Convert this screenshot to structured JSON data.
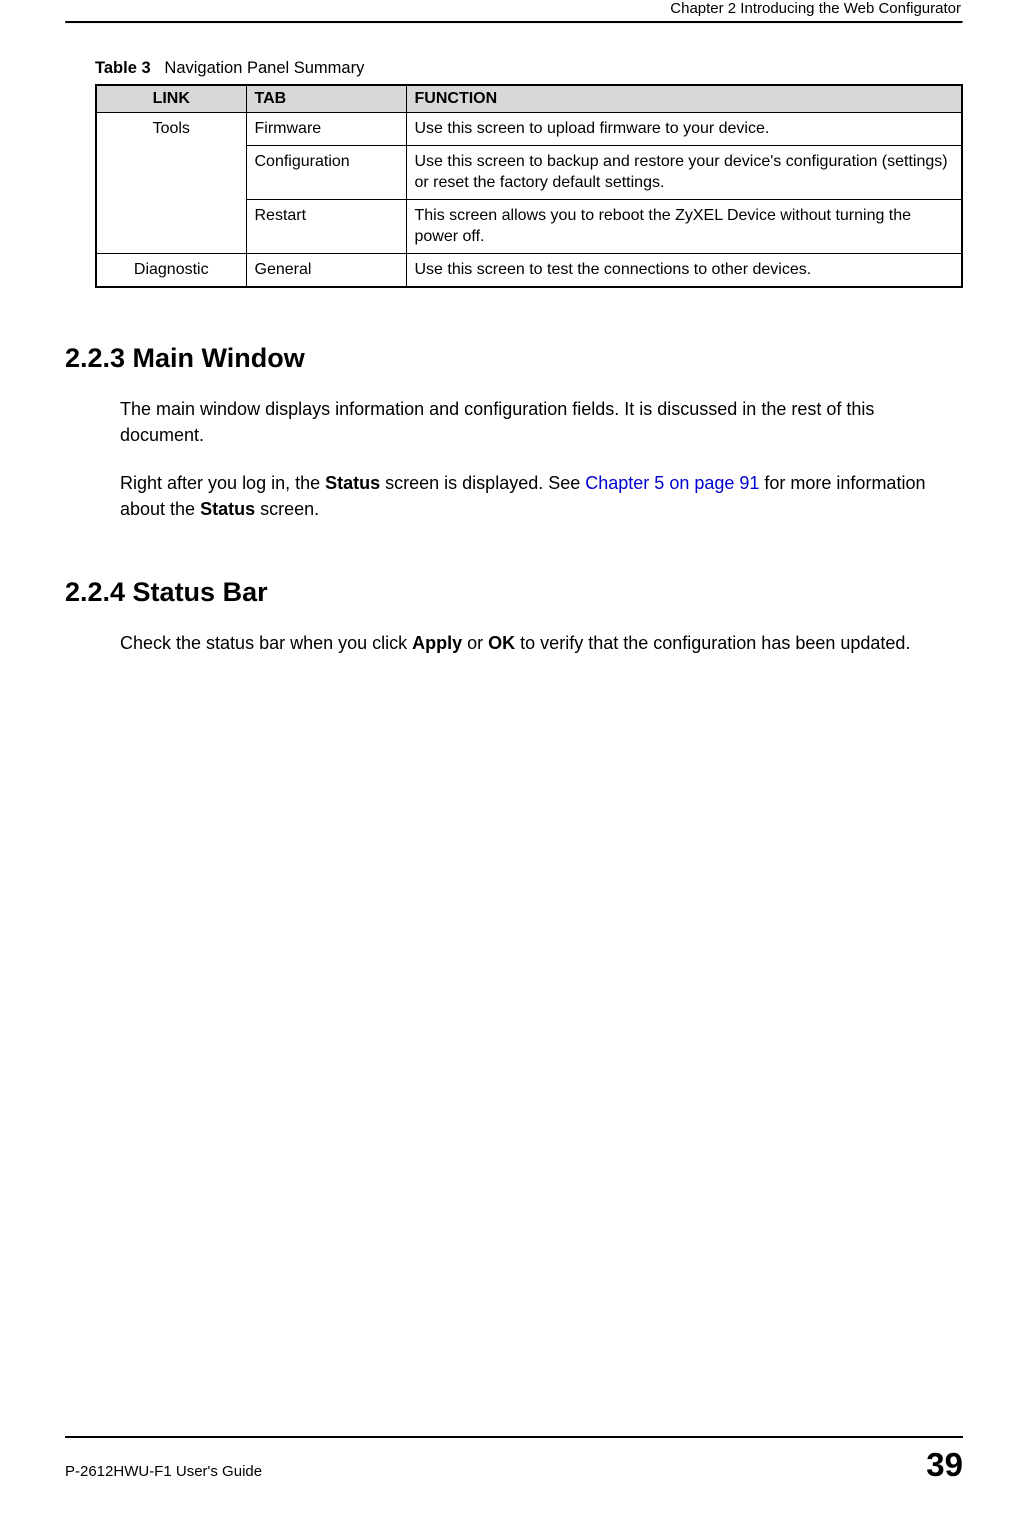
{
  "header": {
    "chapter": "Chapter 2 Introducing the Web Configurator"
  },
  "table": {
    "caption_prefix": "Table 3",
    "caption_text": "Navigation Panel Summary",
    "headers": {
      "link": "LINK",
      "tab": "TAB",
      "function": "FUNCTION"
    },
    "rows": [
      {
        "link": "Tools",
        "tab": "Firmware",
        "function": "Use this screen to upload firmware to your device."
      },
      {
        "link": "",
        "tab": "Configuration",
        "function": "Use this screen to backup and restore your device's configuration (settings) or reset the factory default settings."
      },
      {
        "link": "",
        "tab": "Restart",
        "function": "This screen allows you to reboot the ZyXEL Device without turning the power off."
      },
      {
        "link": "Diagnostic",
        "tab": "General",
        "function": "Use this screen to test the connections to other devices."
      }
    ]
  },
  "sections": {
    "s223": {
      "heading": "2.2.3  Main Window",
      "para1": "The main window displays information and configuration fields. It is discussed in the rest of this document.",
      "para2_pre": "Right after you log in, the ",
      "para2_bold1": "Status",
      "para2_mid1": " screen is displayed. See ",
      "para2_link": "Chapter 5 on page 91",
      "para2_mid2": " for more information about the ",
      "para2_bold2": "Status",
      "para2_post": " screen."
    },
    "s224": {
      "heading": "2.2.4  Status Bar",
      "para1_pre": "Check the status bar when you click ",
      "para1_bold1": "Apply",
      "para1_mid": " or ",
      "para1_bold2": "OK",
      "para1_post": " to verify that the configuration has been updated."
    }
  },
  "footer": {
    "guide": "P-2612HWU-F1 User's Guide",
    "page": "39"
  }
}
